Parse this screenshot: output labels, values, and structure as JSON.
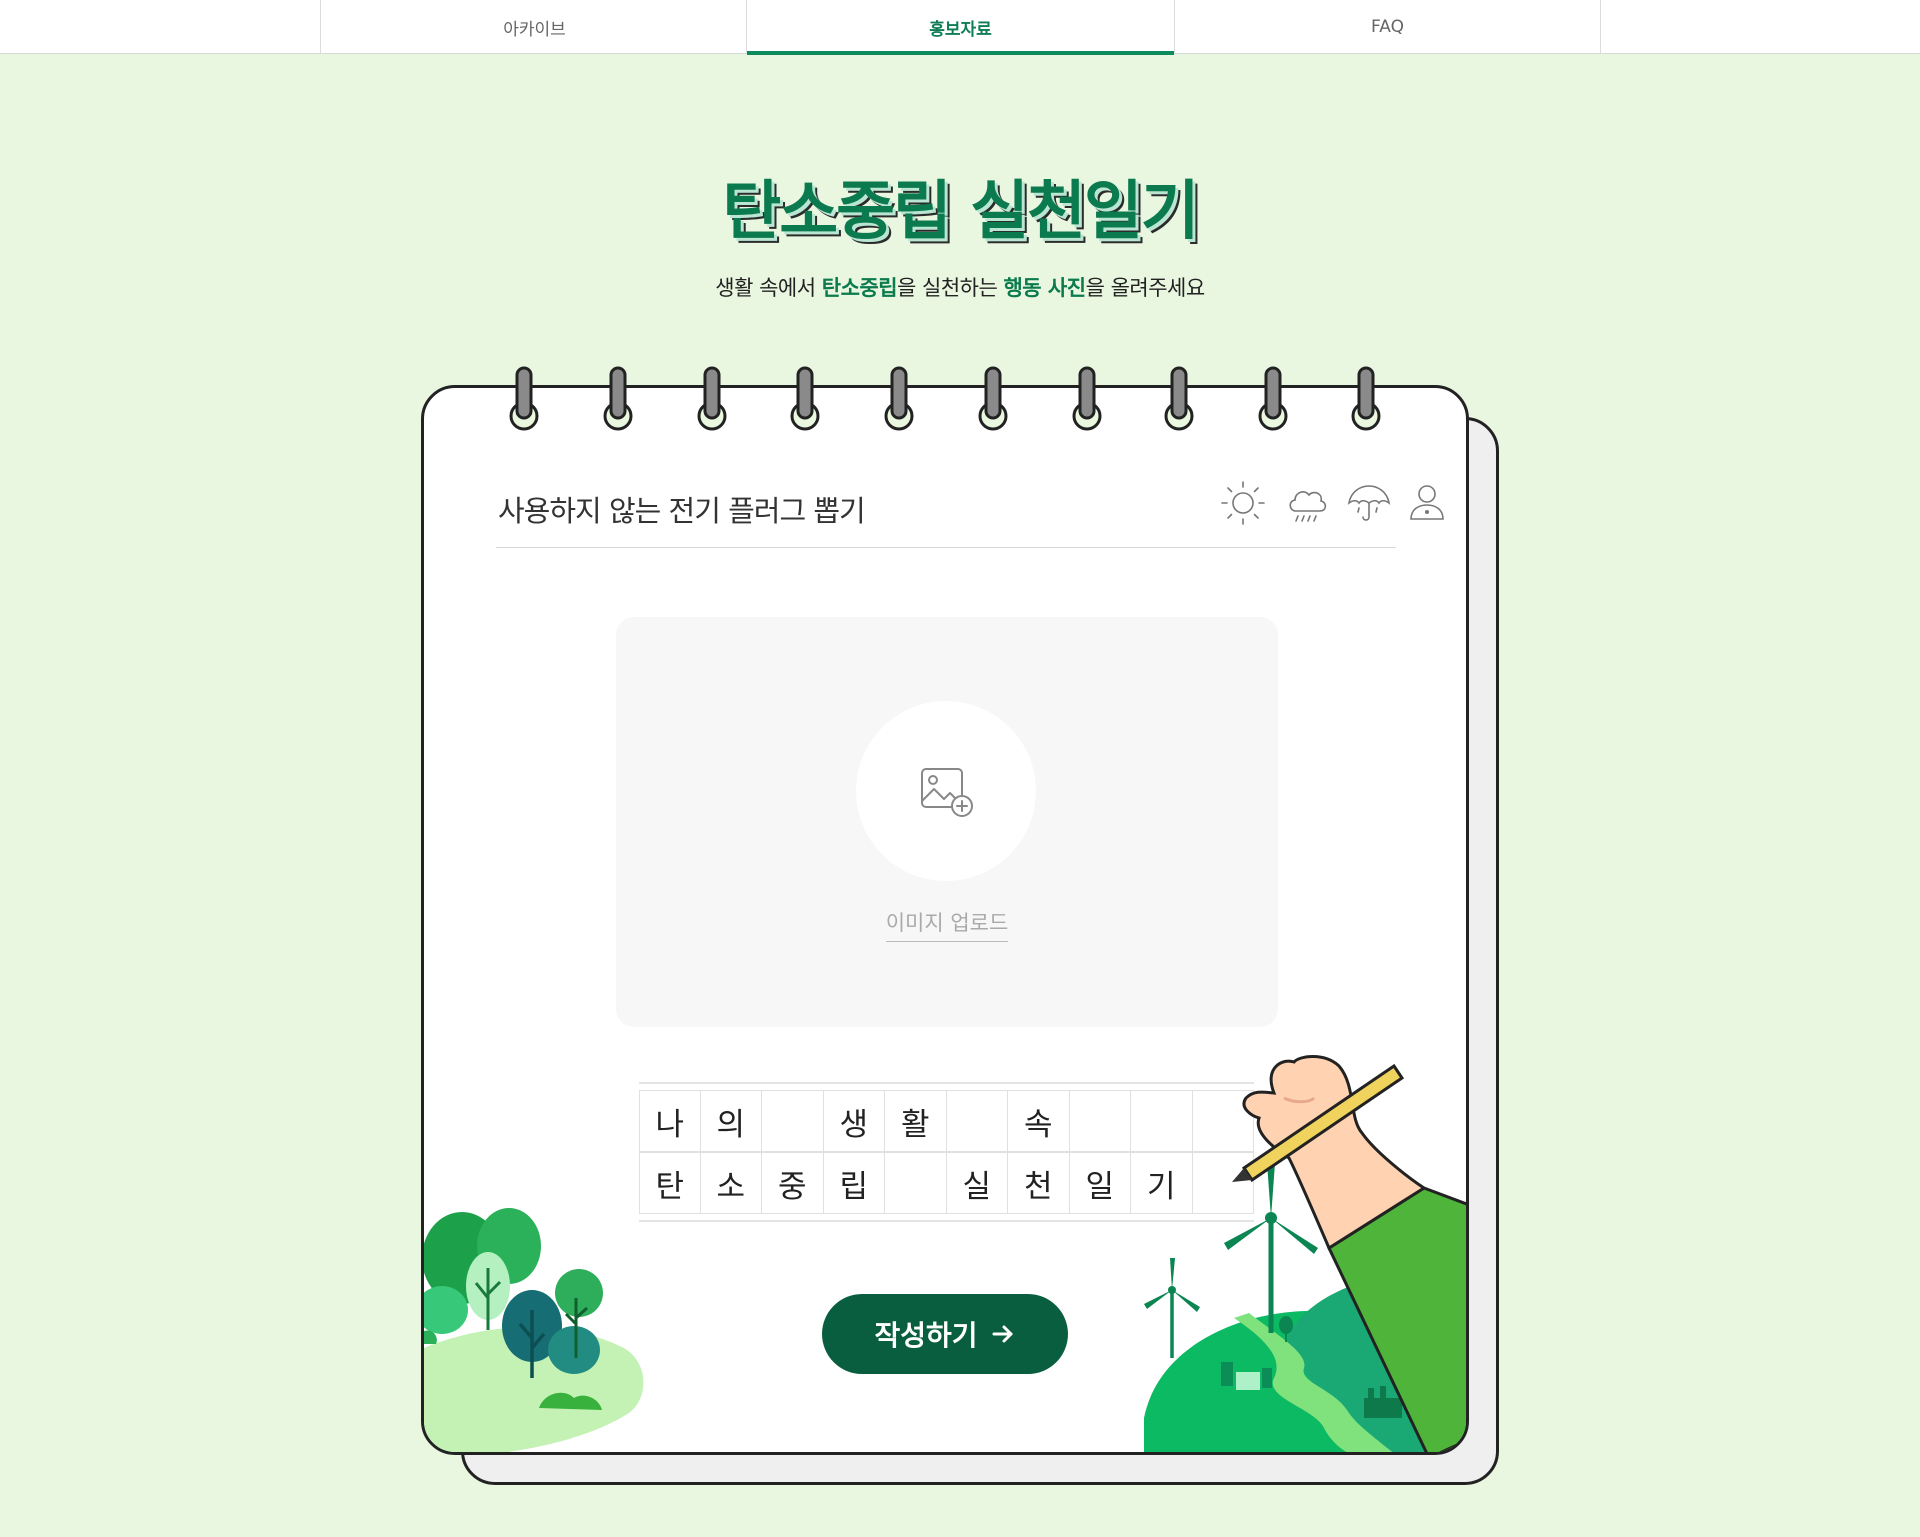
{
  "tabs": [
    {
      "label": "아카이브"
    },
    {
      "label": "홍보자료"
    },
    {
      "label": "FAQ"
    }
  ],
  "active_tab": "홍보자료",
  "title": "탄소중립 실천일기",
  "subtitle": {
    "p1": "생활 속에서 ",
    "h1": "탄소중립",
    "p2": "을 실천하는 ",
    "h2": "행동 사진",
    "p3": "을 올려주세요"
  },
  "diary": {
    "entry_title": "사용하지 않는 전기 플러그 뽑기",
    "weather_icons": [
      "sun-icon",
      "rain-icon",
      "umbrella-icon",
      "person-icon"
    ],
    "upload_label": "이미지 업로드",
    "grid_row1": [
      "나",
      "의",
      "",
      "생",
      "활",
      "",
      "속",
      "",
      "",
      ""
    ],
    "grid_row2": [
      "탄",
      "소",
      "중",
      "립",
      "",
      "실",
      "천",
      "일",
      "기",
      ""
    ],
    "write_button": "작성하기"
  },
  "colors": {
    "page_bg": "#e9f7e1",
    "brand_green": "#0c7a4f",
    "button_bg": "#0a5e40"
  }
}
